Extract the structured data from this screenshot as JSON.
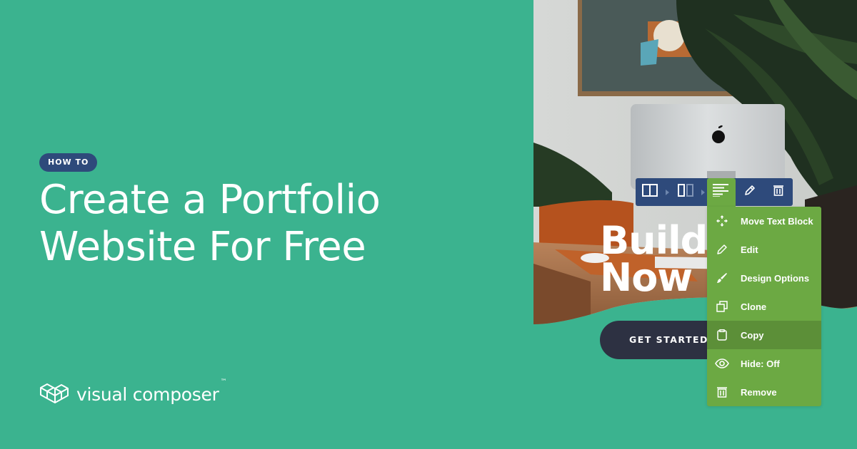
{
  "badge": "HOW TO",
  "headline": {
    "line1": "Create a Portfolio",
    "line2": "Website For Free"
  },
  "brand": {
    "name": "visual composer",
    "trademark": "™"
  },
  "preview": {
    "hero_line1": "Build",
    "hero_line2": "Now",
    "cta_label": "GET STARTED"
  },
  "toolbar": {
    "items": [
      {
        "icon": "row-layout-icon"
      },
      {
        "icon": "column-layout-icon"
      },
      {
        "icon": "text-block-icon",
        "active": true
      },
      {
        "icon": "pencil-icon"
      },
      {
        "icon": "trash-icon"
      }
    ]
  },
  "context_menu": {
    "items": [
      {
        "label": "Move Text Block",
        "icon": "move-icon"
      },
      {
        "label": "Edit",
        "icon": "pencil-icon"
      },
      {
        "label": "Design Options",
        "icon": "brush-icon"
      },
      {
        "label": "Clone",
        "icon": "clone-icon"
      },
      {
        "label": "Copy",
        "icon": "clipboard-icon",
        "hovered": true
      },
      {
        "label": "Hide: Off",
        "icon": "eye-icon"
      },
      {
        "label": "Remove",
        "icon": "trash-icon"
      }
    ]
  },
  "colors": {
    "background": "#3bb38f",
    "badge": "#2e4a7b",
    "toolbar": "#2e4a7b",
    "menu": "#6ca943",
    "menu_hover": "#5c8f38",
    "cta": "#2d3142"
  }
}
